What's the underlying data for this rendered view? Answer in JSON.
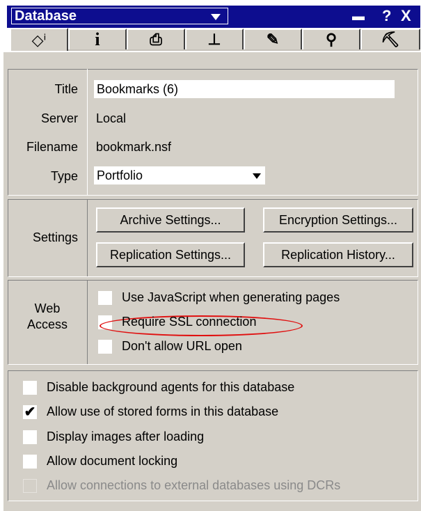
{
  "titlebar": {
    "title": "Database",
    "minimize_glyph": "▬",
    "help_glyph": "?",
    "close_glyph": "X"
  },
  "tabs": [
    {
      "icon": "book-info-icon",
      "glyph": "◇ⁱ"
    },
    {
      "icon": "info-icon",
      "glyph": "i"
    },
    {
      "icon": "printer-icon",
      "glyph": "⎙"
    },
    {
      "icon": "design-icon",
      "glyph": "⊥"
    },
    {
      "icon": "pen-icon",
      "glyph": "✎"
    },
    {
      "icon": "search-icon",
      "glyph": "⚲"
    },
    {
      "icon": "hat-icon",
      "glyph": "⛏"
    }
  ],
  "info": {
    "title_label": "Title",
    "title_value": "Bookmarks (6)",
    "server_label": "Server",
    "server_value": "Local",
    "filename_label": "Filename",
    "filename_value": "bookmark.nsf",
    "type_label": "Type",
    "type_value": "Portfolio"
  },
  "settings": {
    "label": "Settings",
    "archive": "Archive Settings...",
    "encryption": "Encryption Settings...",
    "replication": "Replication Settings...",
    "history": "Replication History..."
  },
  "web_access": {
    "label_line1": "Web",
    "label_line2": "Access",
    "use_js": "Use JavaScript when generating pages",
    "require_ssl": "Require SSL connection",
    "no_url_open": "Don't allow URL open"
  },
  "options": {
    "disable_agents": "Disable background agents for this database",
    "stored_forms": "Allow use of stored forms in this database",
    "display_images": "Display images after loading",
    "doc_locking": "Allow document locking",
    "dcr": "Allow connections to external databases using DCRs",
    "checkmark": "✔"
  },
  "colors": {
    "titlebar": "#0d0d8f",
    "panel": "#d4d0c8",
    "highlight_oval": "#e01010"
  }
}
